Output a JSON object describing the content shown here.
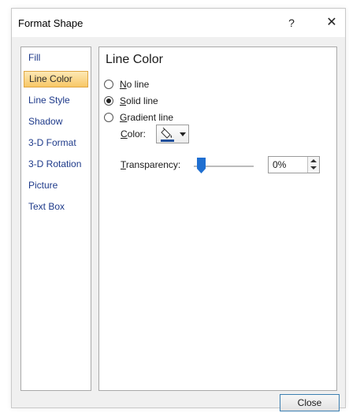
{
  "window": {
    "title": "Format Shape",
    "help_glyph": "?",
    "close_glyph": "✕"
  },
  "nav": {
    "items": [
      {
        "label": "Fill"
      },
      {
        "label": "Line Color",
        "selected": true
      },
      {
        "label": "Line Style"
      },
      {
        "label": "Shadow"
      },
      {
        "label": "3-D Format"
      },
      {
        "label": "3-D Rotation"
      },
      {
        "label": "Picture"
      },
      {
        "label": "Text Box"
      }
    ]
  },
  "panel": {
    "heading": "Line Color",
    "options": {
      "no_line": {
        "mnemonic": "N",
        "rest": "o line",
        "checked": false
      },
      "solid_line": {
        "mnemonic": "S",
        "rest": "olid line",
        "checked": true
      },
      "gradient_line": {
        "mnemonic": "G",
        "rest": "radient line",
        "checked": false
      }
    },
    "color": {
      "mnemonic": "C",
      "rest": "olor:",
      "swatch": "#1f4e9a",
      "icon": "paint-bucket-icon"
    },
    "transparency": {
      "mnemonic": "T",
      "rest": "ransparency:",
      "value": "0%",
      "percent": 0
    }
  },
  "footer": {
    "close_label": "Close"
  },
  "colors": {
    "selected_tab_top": "#fde9b6",
    "selected_tab_bottom": "#f8c766",
    "nav_text": "#1e3a8a",
    "slider_thumb": "#1f6fd1",
    "close_button_border": "#3c7fb1"
  }
}
